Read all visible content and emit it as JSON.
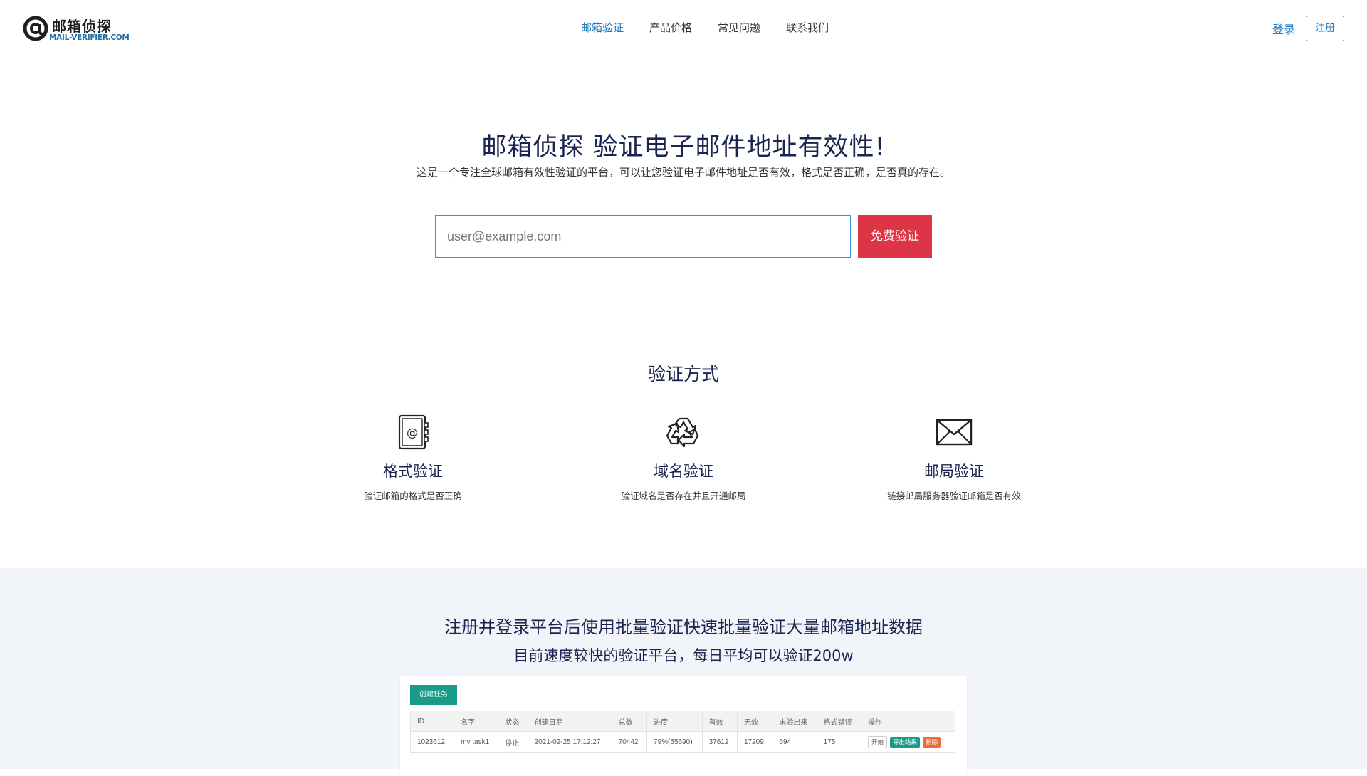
{
  "header": {
    "logo_cn": "邮箱侦探",
    "logo_en": "MAIL-VERIFIER.COM",
    "nav": [
      {
        "label": "邮箱验证",
        "active": true
      },
      {
        "label": "产品价格",
        "active": false
      },
      {
        "label": "常见问题",
        "active": false
      },
      {
        "label": "联系我们",
        "active": false
      }
    ],
    "login_label": "登录",
    "register_label": "注册"
  },
  "hero": {
    "title": "邮箱侦探 验证电子邮件地址有效性!",
    "subtitle": "这是一个专注全球邮箱有效性验证的平台，可以让您验证电子邮件地址是否有效，格式是否正确，是否真的存在。",
    "email_placeholder": "user@example.com",
    "email_value": "",
    "verify_label": "免费验证"
  },
  "methods": {
    "title": "验证方式",
    "items": [
      {
        "icon": "address-book-icon",
        "name": "格式验证",
        "desc": "验证邮箱的格式是否正确"
      },
      {
        "icon": "recycle-icon",
        "name": "域名验证",
        "desc": "验证域名是否存在并且开通邮局"
      },
      {
        "icon": "envelope-icon",
        "name": "邮局验证",
        "desc": "链接邮局服务器验证邮箱是否有效"
      }
    ]
  },
  "batch": {
    "title": "注册并登录平台后使用批量验证快速批量验证大量邮箱地址数据",
    "subtitle": "目前速度较快的验证平台，每日平均可以验证200w",
    "create_task_label": "创建任务",
    "table": {
      "headers": [
        "ID",
        "名字",
        "状态",
        "创建日期",
        "总数",
        "进度",
        "有效",
        "无效",
        "未验出来",
        "格式错误",
        "操作"
      ],
      "rows": [
        [
          "1023612",
          "my task1",
          "停止",
          "2021-02-25 17:12:27",
          "70442",
          "79%(55690)",
          "37612",
          "17209",
          "694",
          "175"
        ]
      ],
      "actions": {
        "start": "开始",
        "export": "导出结果",
        "delete": "删除"
      }
    }
  }
}
